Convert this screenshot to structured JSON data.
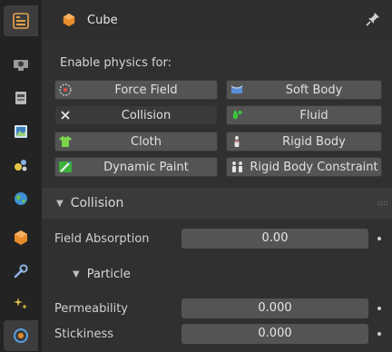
{
  "header": {
    "object_name": "Cube"
  },
  "enable_label": "Enable physics for:",
  "physics_buttons": {
    "force_field": "Force Field",
    "soft_body": "Soft Body",
    "collision": "Collision",
    "fluid": "Fluid",
    "cloth": "Cloth",
    "rigid_body": "Rigid Body",
    "dynamic_paint": "Dynamic Paint",
    "rigid_body_constraint": "Rigid Body Constraint"
  },
  "collision_section": {
    "title": "Collision",
    "field_absorption": {
      "label": "Field Absorption",
      "value": "0.00"
    }
  },
  "particle_section": {
    "title": "Particle",
    "permeability": {
      "label": "Permeability",
      "value": "0.000"
    },
    "stickiness": {
      "label": "Stickiness",
      "value": "0.000"
    }
  },
  "colors": {
    "panel_bg": "#303030",
    "button_bg": "#545454",
    "accent_orange": "#e88b2a",
    "fluid_green": "#3bc43b",
    "cloth_green": "#7bd34c",
    "soft_body_blue": "#5a8dd6"
  }
}
